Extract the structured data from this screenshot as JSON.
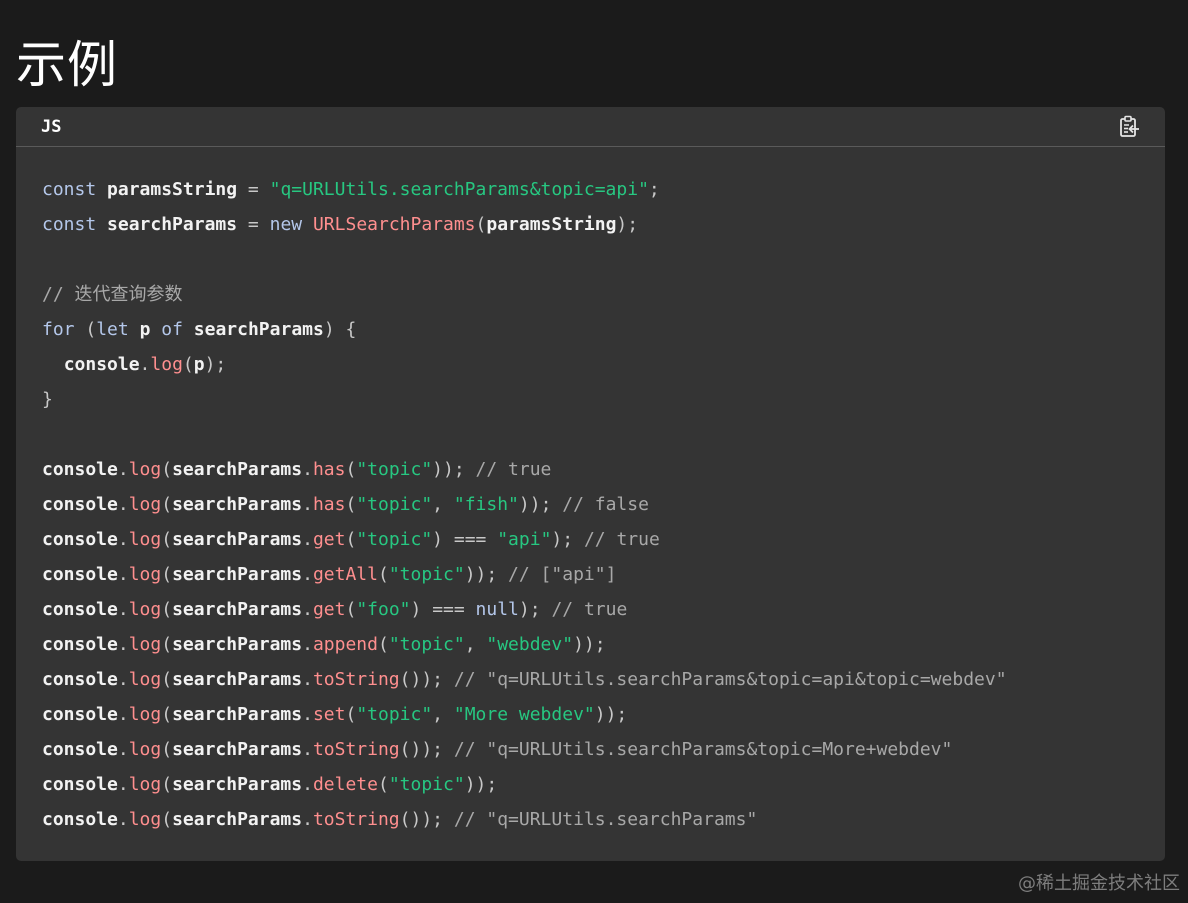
{
  "page": {
    "title": "示例"
  },
  "code_block": {
    "language": "JS",
    "copy_icon": "clipboard-copy-icon",
    "colors": {
      "background": "#343434",
      "keyword": "#b4c7ea",
      "string": "#27c781",
      "function": "#ff8f8f",
      "comment": "#a8a8a8",
      "identifier": "#f2f2f2"
    },
    "lines": [
      [
        [
          "kw",
          "const"
        ],
        [
          "sp",
          " "
        ],
        [
          "tx",
          "paramsString"
        ],
        [
          "sp",
          " "
        ],
        [
          "pn",
          "="
        ],
        [
          "sp",
          " "
        ],
        [
          "str",
          "\"q=URLUtils.searchParams&topic=api\""
        ],
        [
          "pn",
          ";"
        ]
      ],
      [
        [
          "kw",
          "const"
        ],
        [
          "sp",
          " "
        ],
        [
          "tx",
          "searchParams"
        ],
        [
          "sp",
          " "
        ],
        [
          "pn",
          "="
        ],
        [
          "sp",
          " "
        ],
        [
          "kw",
          "new"
        ],
        [
          "sp",
          " "
        ],
        [
          "fn",
          "URLSearchParams"
        ],
        [
          "pn",
          "("
        ],
        [
          "tx",
          "paramsString"
        ],
        [
          "pn",
          ");"
        ]
      ],
      [],
      [
        [
          "cm",
          "// 迭代查询参数"
        ]
      ],
      [
        [
          "kw",
          "for"
        ],
        [
          "sp",
          " "
        ],
        [
          "pn",
          "("
        ],
        [
          "kw",
          "let"
        ],
        [
          "sp",
          " "
        ],
        [
          "tx",
          "p"
        ],
        [
          "sp",
          " "
        ],
        [
          "kw",
          "of"
        ],
        [
          "sp",
          " "
        ],
        [
          "tx",
          "searchParams"
        ],
        [
          "pn",
          ")"
        ],
        [
          "sp",
          " "
        ],
        [
          "pn",
          "{"
        ]
      ],
      [
        [
          "sp",
          "  "
        ],
        [
          "tx",
          "console"
        ],
        [
          "pn",
          "."
        ],
        [
          "fn",
          "log"
        ],
        [
          "pn",
          "("
        ],
        [
          "tx",
          "p"
        ],
        [
          "pn",
          ");"
        ]
      ],
      [
        [
          "pn",
          "}"
        ]
      ],
      [],
      [
        [
          "tx",
          "console"
        ],
        [
          "pn",
          "."
        ],
        [
          "fn",
          "log"
        ],
        [
          "pn",
          "("
        ],
        [
          "tx",
          "searchParams"
        ],
        [
          "pn",
          "."
        ],
        [
          "fn",
          "has"
        ],
        [
          "pn",
          "("
        ],
        [
          "str",
          "\"topic\""
        ],
        [
          "pn",
          "));"
        ],
        [
          "sp",
          " "
        ],
        [
          "cm",
          "// true"
        ]
      ],
      [
        [
          "tx",
          "console"
        ],
        [
          "pn",
          "."
        ],
        [
          "fn",
          "log"
        ],
        [
          "pn",
          "("
        ],
        [
          "tx",
          "searchParams"
        ],
        [
          "pn",
          "."
        ],
        [
          "fn",
          "has"
        ],
        [
          "pn",
          "("
        ],
        [
          "str",
          "\"topic\""
        ],
        [
          "pn",
          ","
        ],
        [
          "sp",
          " "
        ],
        [
          "str",
          "\"fish\""
        ],
        [
          "pn",
          "));"
        ],
        [
          "sp",
          " "
        ],
        [
          "cm",
          "// false"
        ]
      ],
      [
        [
          "tx",
          "console"
        ],
        [
          "pn",
          "."
        ],
        [
          "fn",
          "log"
        ],
        [
          "pn",
          "("
        ],
        [
          "tx",
          "searchParams"
        ],
        [
          "pn",
          "."
        ],
        [
          "fn",
          "get"
        ],
        [
          "pn",
          "("
        ],
        [
          "str",
          "\"topic\""
        ],
        [
          "pn",
          ")"
        ],
        [
          "sp",
          " "
        ],
        [
          "pn",
          "==="
        ],
        [
          "sp",
          " "
        ],
        [
          "str",
          "\"api\""
        ],
        [
          "pn",
          ");"
        ],
        [
          "sp",
          " "
        ],
        [
          "cm",
          "// true"
        ]
      ],
      [
        [
          "tx",
          "console"
        ],
        [
          "pn",
          "."
        ],
        [
          "fn",
          "log"
        ],
        [
          "pn",
          "("
        ],
        [
          "tx",
          "searchParams"
        ],
        [
          "pn",
          "."
        ],
        [
          "fn",
          "getAll"
        ],
        [
          "pn",
          "("
        ],
        [
          "str",
          "\"topic\""
        ],
        [
          "pn",
          "));"
        ],
        [
          "sp",
          " "
        ],
        [
          "cm",
          "// [\"api\"]"
        ]
      ],
      [
        [
          "tx",
          "console"
        ],
        [
          "pn",
          "."
        ],
        [
          "fn",
          "log"
        ],
        [
          "pn",
          "("
        ],
        [
          "tx",
          "searchParams"
        ],
        [
          "pn",
          "."
        ],
        [
          "fn",
          "get"
        ],
        [
          "pn",
          "("
        ],
        [
          "str",
          "\"foo\""
        ],
        [
          "pn",
          ")"
        ],
        [
          "sp",
          " "
        ],
        [
          "pn",
          "==="
        ],
        [
          "sp",
          " "
        ],
        [
          "kw",
          "null"
        ],
        [
          "pn",
          ");"
        ],
        [
          "sp",
          " "
        ],
        [
          "cm",
          "// true"
        ]
      ],
      [
        [
          "tx",
          "console"
        ],
        [
          "pn",
          "."
        ],
        [
          "fn",
          "log"
        ],
        [
          "pn",
          "("
        ],
        [
          "tx",
          "searchParams"
        ],
        [
          "pn",
          "."
        ],
        [
          "fn",
          "append"
        ],
        [
          "pn",
          "("
        ],
        [
          "str",
          "\"topic\""
        ],
        [
          "pn",
          ","
        ],
        [
          "sp",
          " "
        ],
        [
          "str",
          "\"webdev\""
        ],
        [
          "pn",
          "));"
        ]
      ],
      [
        [
          "tx",
          "console"
        ],
        [
          "pn",
          "."
        ],
        [
          "fn",
          "log"
        ],
        [
          "pn",
          "("
        ],
        [
          "tx",
          "searchParams"
        ],
        [
          "pn",
          "."
        ],
        [
          "fn",
          "toString"
        ],
        [
          "pn",
          "());"
        ],
        [
          "sp",
          " "
        ],
        [
          "cm",
          "// \"q=URLUtils.searchParams&topic=api&topic=webdev\""
        ]
      ],
      [
        [
          "tx",
          "console"
        ],
        [
          "pn",
          "."
        ],
        [
          "fn",
          "log"
        ],
        [
          "pn",
          "("
        ],
        [
          "tx",
          "searchParams"
        ],
        [
          "pn",
          "."
        ],
        [
          "fn",
          "set"
        ],
        [
          "pn",
          "("
        ],
        [
          "str",
          "\"topic\""
        ],
        [
          "pn",
          ","
        ],
        [
          "sp",
          " "
        ],
        [
          "str",
          "\"More webdev\""
        ],
        [
          "pn",
          "));"
        ]
      ],
      [
        [
          "tx",
          "console"
        ],
        [
          "pn",
          "."
        ],
        [
          "fn",
          "log"
        ],
        [
          "pn",
          "("
        ],
        [
          "tx",
          "searchParams"
        ],
        [
          "pn",
          "."
        ],
        [
          "fn",
          "toString"
        ],
        [
          "pn",
          "());"
        ],
        [
          "sp",
          " "
        ],
        [
          "cm",
          "// \"q=URLUtils.searchParams&topic=More+webdev\""
        ]
      ],
      [
        [
          "tx",
          "console"
        ],
        [
          "pn",
          "."
        ],
        [
          "fn",
          "log"
        ],
        [
          "pn",
          "("
        ],
        [
          "tx",
          "searchParams"
        ],
        [
          "pn",
          "."
        ],
        [
          "fn",
          "delete"
        ],
        [
          "pn",
          "("
        ],
        [
          "str",
          "\"topic\""
        ],
        [
          "pn",
          "));"
        ]
      ],
      [
        [
          "tx",
          "console"
        ],
        [
          "pn",
          "."
        ],
        [
          "fn",
          "log"
        ],
        [
          "pn",
          "("
        ],
        [
          "tx",
          "searchParams"
        ],
        [
          "pn",
          "."
        ],
        [
          "fn",
          "toString"
        ],
        [
          "pn",
          "());"
        ],
        [
          "sp",
          " "
        ],
        [
          "cm",
          "// \"q=URLUtils.searchParams\""
        ]
      ]
    ]
  },
  "watermark": {
    "text": "@稀土掘金技术社区"
  }
}
